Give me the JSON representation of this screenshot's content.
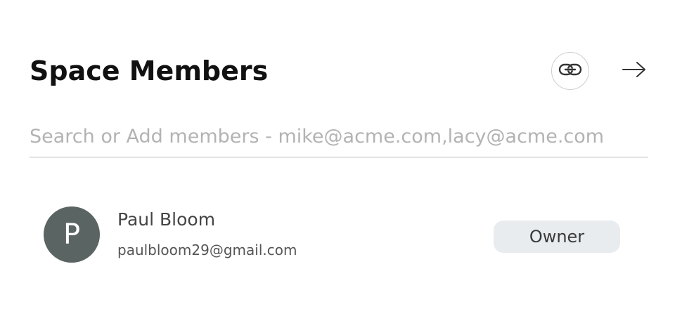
{
  "header": {
    "title": "Space Members",
    "link_icon": "link-icon",
    "arrow_icon": "arrow-right-icon"
  },
  "search": {
    "placeholder": "Search or Add members - mike@acme.com,lacy@acme.com",
    "value": ""
  },
  "members": [
    {
      "initial": "P",
      "name": "Paul Bloom",
      "email": "paulbloom29@gmail.com",
      "role": "Owner",
      "avatar_color": "#5a6462"
    }
  ],
  "colors": {
    "title": "#111111",
    "badge_bg": "#e8ecef",
    "divider": "#e3e3e3"
  }
}
